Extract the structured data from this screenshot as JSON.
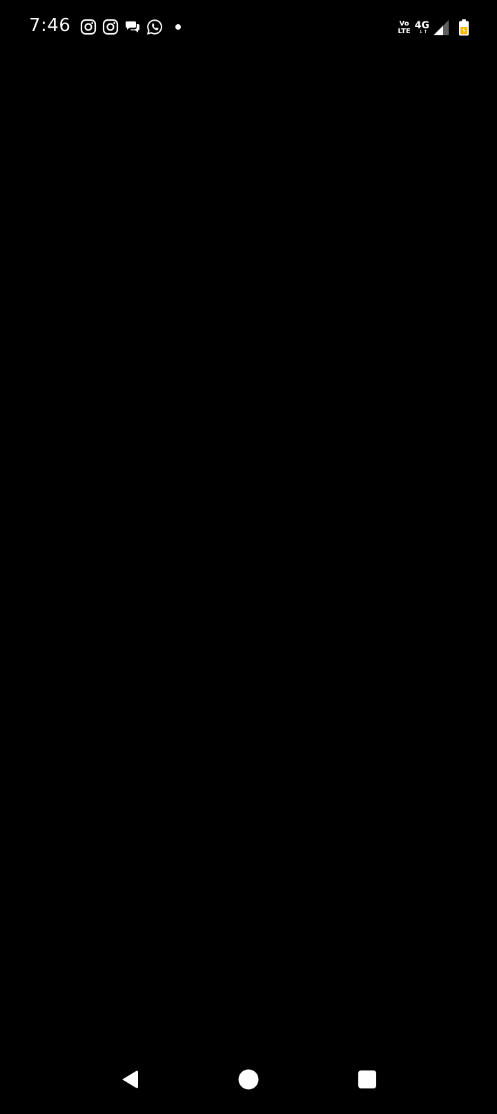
{
  "status_bar": {
    "time": "7:46",
    "notification_icons": [
      "instagram-icon",
      "instagram-icon",
      "chat-bubbles-icon",
      "whatsapp-icon",
      "more-notifications-dot"
    ],
    "volte_top": "Vo",
    "volte_bottom": "LTE",
    "network_type": "4G",
    "network_activity": "↓↑",
    "signal_icon": "signal-strength-icon",
    "battery_icon": "battery-icon",
    "battery_color": "#f5b800"
  },
  "content": {
    "background": "#000000"
  },
  "nav_bar": {
    "buttons": [
      "back-button",
      "home-button",
      "recents-button"
    ]
  }
}
